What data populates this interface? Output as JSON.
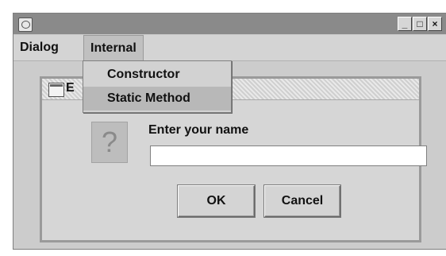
{
  "window": {
    "controls": {
      "minimize": "_",
      "maximize": "□",
      "close": "×"
    }
  },
  "menubar": {
    "items": [
      {
        "label": "Dialog"
      },
      {
        "label": "Internal"
      }
    ]
  },
  "popup": {
    "items": [
      {
        "label": "Constructor"
      },
      {
        "label": "Static Method"
      }
    ]
  },
  "internal_frame": {
    "title_visible": "E"
  },
  "dialog": {
    "icon": "question-icon",
    "prompt": "Enter your name",
    "input_value": "",
    "ok_label": "OK",
    "cancel_label": "Cancel"
  }
}
